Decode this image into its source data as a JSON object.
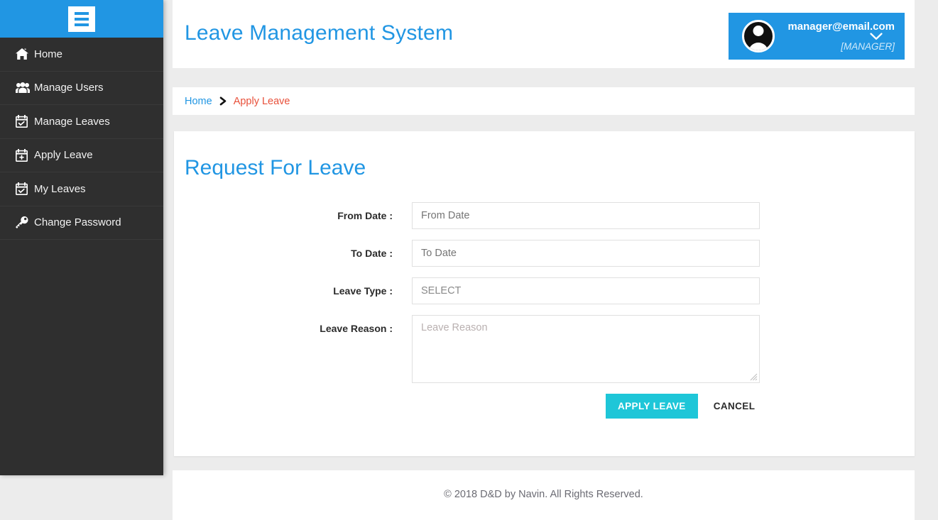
{
  "sidebar": {
    "toggle_icon": "hamburger-icon",
    "items": [
      {
        "label": "Home",
        "icon": "home-icon"
      },
      {
        "label": "Manage Users",
        "icon": "users-icon"
      },
      {
        "label": "Manage Leaves",
        "icon": "calendar-check-icon"
      },
      {
        "label": "Apply Leave",
        "icon": "calendar-plus-icon"
      },
      {
        "label": "My Leaves",
        "icon": "calendar-check-icon"
      },
      {
        "label": "Change Password",
        "icon": "key-icon"
      }
    ]
  },
  "header": {
    "title": "Leave Management System",
    "user": {
      "email": "manager@email.com",
      "role": "[MANAGER]",
      "avatar_icon": "user-avatar-icon",
      "caret_icon": "chevron-down-icon"
    }
  },
  "breadcrumb": {
    "home": "Home",
    "separator_icon": "chevron-right-icon",
    "current": "Apply Leave"
  },
  "main": {
    "title": "Request For Leave",
    "fields": [
      {
        "label": "From Date :",
        "placeholder": "From Date",
        "value": ""
      },
      {
        "label": "To Date :",
        "placeholder": "To Date",
        "value": ""
      },
      {
        "label": "Leave Type :",
        "placeholder": "SELECT",
        "value": "SELECT"
      },
      {
        "label": "Leave Reason :",
        "placeholder": "Leave Reason",
        "value": ""
      }
    ],
    "submit_label": "APPLY LEAVE",
    "cancel_label": "CANCEL"
  },
  "footer": {
    "text": "© 2018 D&D by Navin. All Rights Reserved."
  },
  "colors": {
    "header_blue": "#2196e3",
    "sidebar_dark": "#2f2f2f",
    "submit_cyan": "#1ec6d8",
    "breadcrumb_current": "#e8503a",
    "page_bg": "#ececec"
  }
}
